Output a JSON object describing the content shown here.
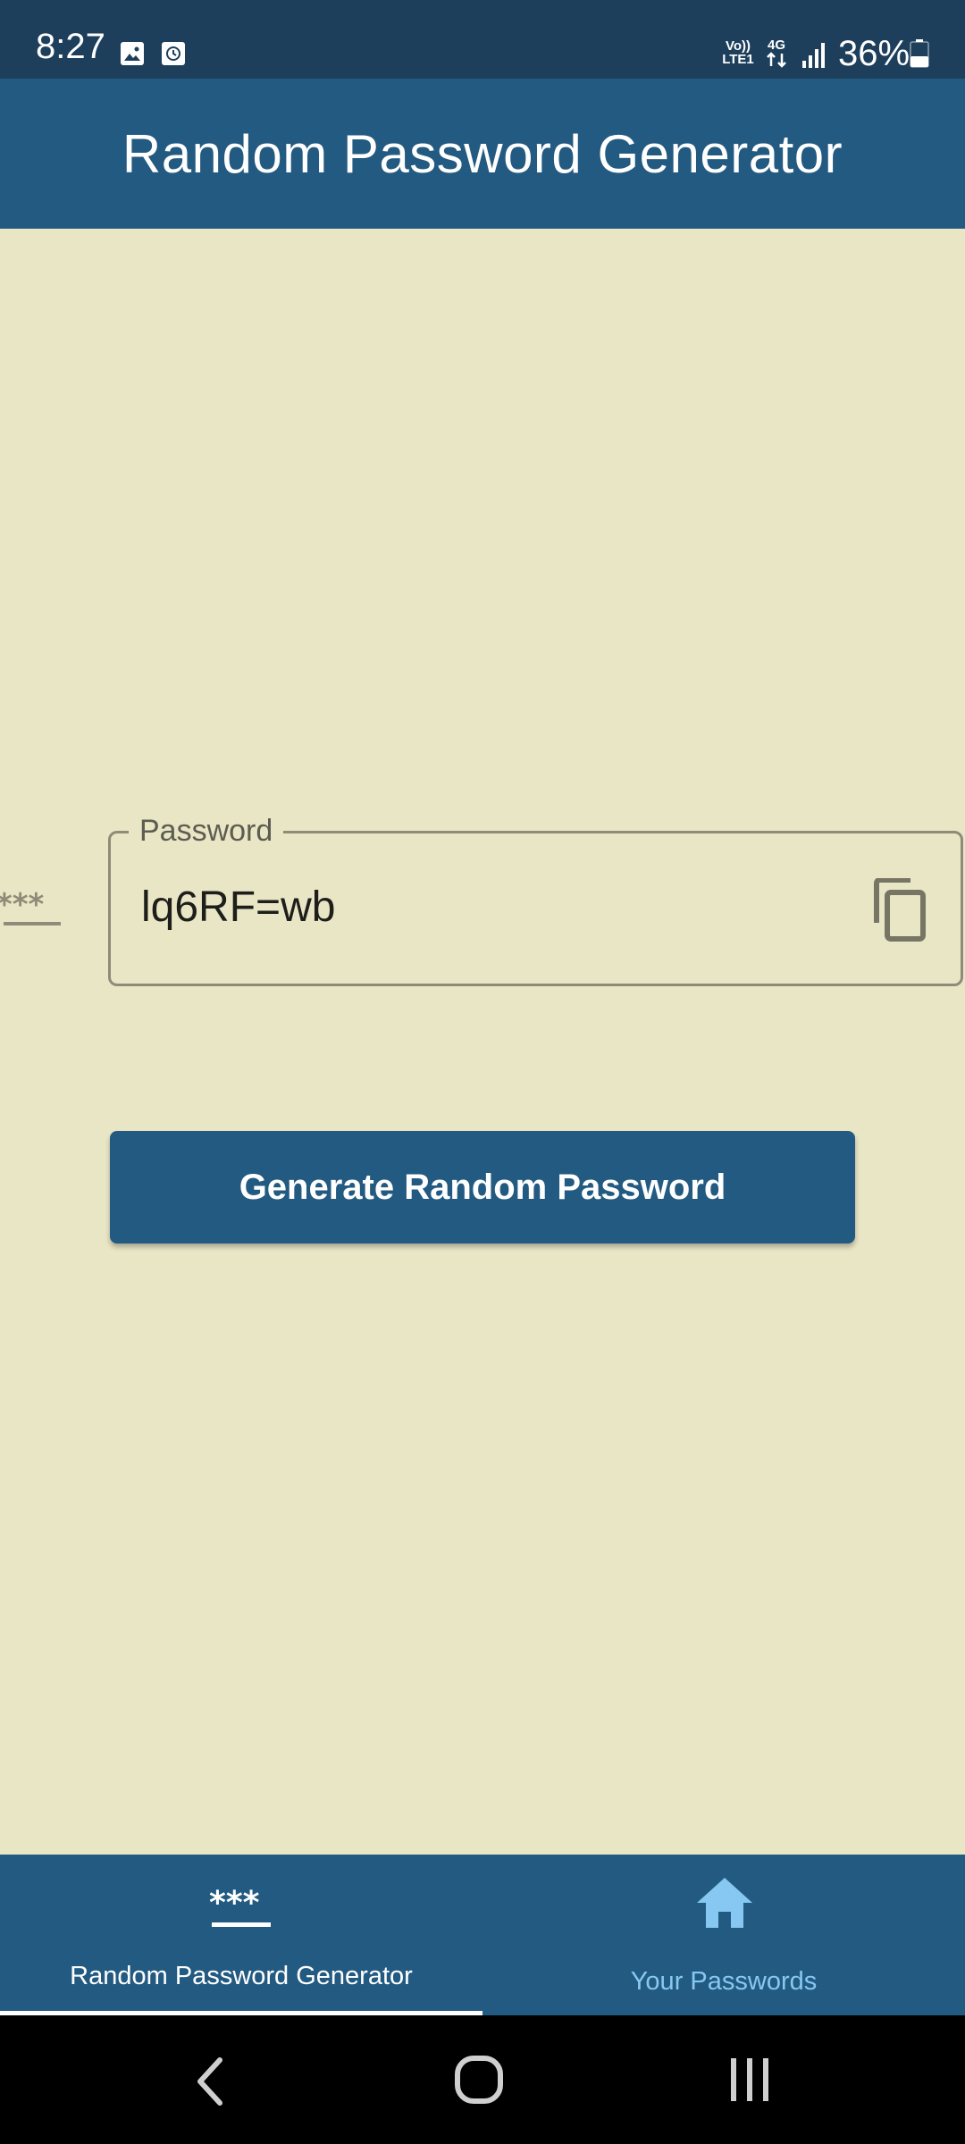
{
  "status_bar": {
    "time": "8:27",
    "volte_line1": "Vo))",
    "volte_line2": "LTE1",
    "network_type": "4G",
    "battery_percent": "36%",
    "battery_level": 0.36,
    "icons": [
      "image-icon",
      "clock-icon",
      "volte-icon",
      "4g-data-icon",
      "signal-icon",
      "battery-icon"
    ]
  },
  "app_bar": {
    "title": "Random Password Generator"
  },
  "password_field": {
    "label": "Password",
    "value": "lq6RF=wb",
    "prefix_icon": "password-stars-icon",
    "suffix_icon": "copy-icon"
  },
  "generate_button": {
    "label": "Generate Random Password"
  },
  "bottom_nav": {
    "items": [
      {
        "label": "Random Password Generator",
        "icon": "password-stars-icon",
        "active": true
      },
      {
        "label": "Your Passwords",
        "icon": "home-icon",
        "active": false
      }
    ]
  },
  "system_nav": {
    "buttons": [
      "back-icon",
      "home-circle-icon",
      "recents-icon"
    ]
  },
  "colors": {
    "status_bar": "#1d3f5c",
    "primary": "#235a81",
    "background": "#e9e6c6",
    "outline": "#8e8c78",
    "inactive_nav": "#86c8f2",
    "text_dark": "#1e1e1a"
  }
}
